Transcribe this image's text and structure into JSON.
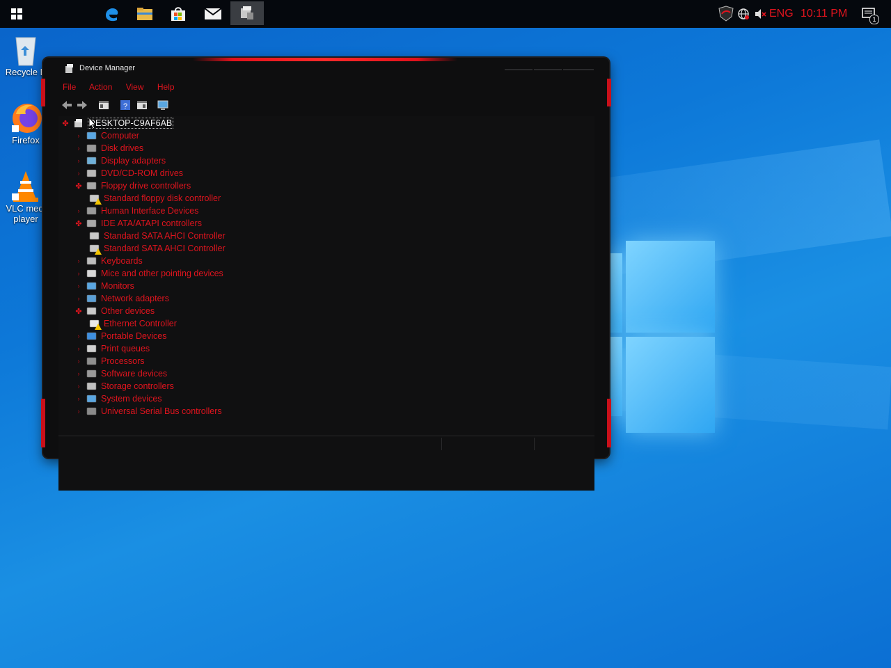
{
  "taskbar": {
    "tray": {
      "language": "ENG",
      "time": "10:11 PM",
      "notification_count": "1"
    }
  },
  "desktop": {
    "icons": [
      {
        "label": "Recycle B"
      },
      {
        "label": "Firefox"
      },
      {
        "label": "VLC medi player"
      }
    ]
  },
  "window": {
    "title": "Device Manager",
    "menu": [
      "File",
      "Action",
      "View",
      "Help"
    ],
    "tree": {
      "root": "DESKTOP-C9AF6AB",
      "items": [
        {
          "label": "Computer",
          "level": 1,
          "expanded": false
        },
        {
          "label": "Disk drives",
          "level": 1,
          "expanded": false
        },
        {
          "label": "Display adapters",
          "level": 1,
          "expanded": false
        },
        {
          "label": "DVD/CD-ROM drives",
          "level": 1,
          "expanded": false
        },
        {
          "label": "Floppy drive controllers",
          "level": 1,
          "expanded": true
        },
        {
          "label": "Standard floppy disk controller",
          "level": 2,
          "warning": true
        },
        {
          "label": "Human Interface Devices",
          "level": 1,
          "expanded": false
        },
        {
          "label": "IDE ATA/ATAPI controllers",
          "level": 1,
          "expanded": true
        },
        {
          "label": "Standard SATA AHCI Controller",
          "level": 2,
          "warning": false
        },
        {
          "label": "Standard SATA AHCI Controller",
          "level": 2,
          "warning": true
        },
        {
          "label": "Keyboards",
          "level": 1,
          "expanded": false
        },
        {
          "label": "Mice and other pointing devices",
          "level": 1,
          "expanded": false
        },
        {
          "label": "Monitors",
          "level": 1,
          "expanded": false
        },
        {
          "label": "Network adapters",
          "level": 1,
          "expanded": false
        },
        {
          "label": "Other devices",
          "level": 1,
          "expanded": true
        },
        {
          "label": "Ethernet Controller",
          "level": 2,
          "warning": true
        },
        {
          "label": "Portable Devices",
          "level": 1,
          "expanded": false
        },
        {
          "label": "Print queues",
          "level": 1,
          "expanded": false
        },
        {
          "label": "Processors",
          "level": 1,
          "expanded": false
        },
        {
          "label": "Software devices",
          "level": 1,
          "expanded": false
        },
        {
          "label": "Storage controllers",
          "level": 1,
          "expanded": false
        },
        {
          "label": "System devices",
          "level": 1,
          "expanded": false
        },
        {
          "label": "Universal Serial Bus controllers",
          "level": 1,
          "expanded": false
        }
      ]
    }
  },
  "colors": {
    "accent": "#e0141e",
    "taskbar": "#05080d",
    "window_bg": "#0e0e0f",
    "desktop": "#0d78d8"
  }
}
